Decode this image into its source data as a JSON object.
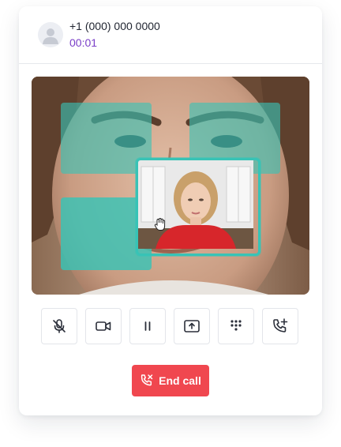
{
  "caller": {
    "phone_number": "+1 (000) 000 0000",
    "call_duration": "00:01",
    "avatar_icon": "user-silhouette-icon"
  },
  "video": {
    "main_feed": "remote-participant-video",
    "pip_feed": "local-self-view-video",
    "highlight_color": "#38c3b6",
    "cursor_icon": "grab-hand-icon"
  },
  "controls": [
    {
      "icon": "microphone-off-icon",
      "label": "Mute"
    },
    {
      "icon": "video-camera-icon",
      "label": "Video"
    },
    {
      "icon": "pause-icon",
      "label": "Hold"
    },
    {
      "icon": "screen-share-icon",
      "label": "Share screen"
    },
    {
      "icon": "dialpad-icon",
      "label": "Keypad"
    },
    {
      "icon": "add-call-icon",
      "label": "Add call"
    }
  ],
  "end_call": {
    "label": "End call",
    "icon": "phone-hangup-icon",
    "color": "#f0474f"
  },
  "theme": {
    "accent_purple": "#7a3fc8",
    "text_dark": "#1f2430",
    "border": "#e3e5ea"
  }
}
